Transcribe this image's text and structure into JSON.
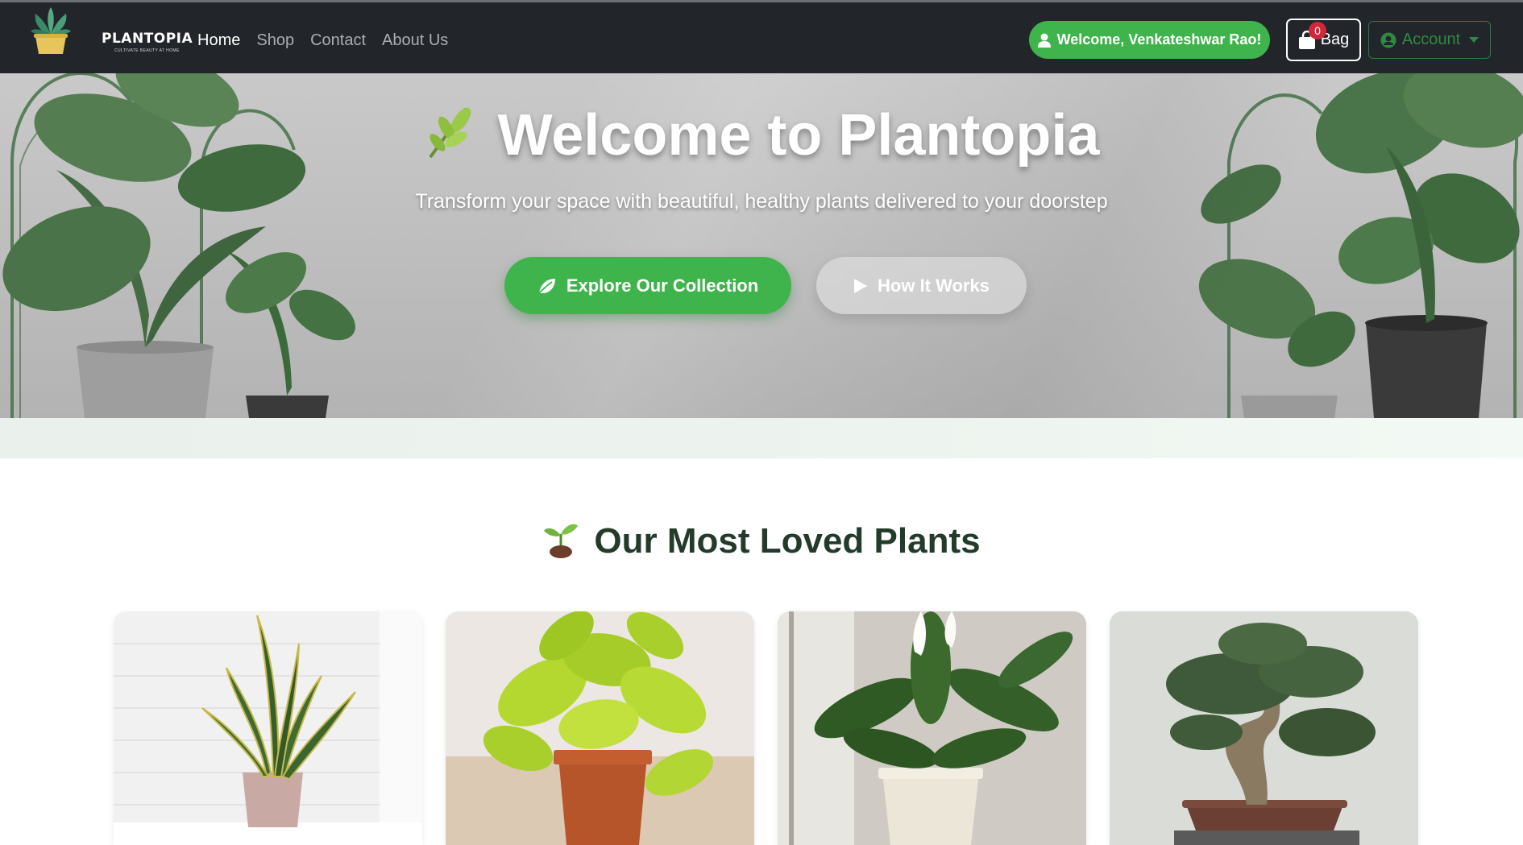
{
  "brand": {
    "name": "PLANTOPIA",
    "tagline": "CULTIVATE BEAUTY AT HOME",
    "logo_icon": "potted-plant-logo"
  },
  "nav": {
    "links": [
      {
        "label": "Home",
        "active": true
      },
      {
        "label": "Shop",
        "active": false
      },
      {
        "label": "Contact",
        "active": false
      },
      {
        "label": "About Us",
        "active": false
      }
    ],
    "welcome": "Welcome, Venkateshwar Rao!",
    "bag_label": "Bag",
    "bag_count": "0",
    "account_label": "Account"
  },
  "hero": {
    "title": "Welcome to Plantopia",
    "subtitle": "Transform your space with beautiful, healthy plants delivered to your doorstep",
    "explore_label": "Explore Our Collection",
    "how_label": "How It Works"
  },
  "section": {
    "title": "Our Most Loved Plants"
  },
  "products": [
    {
      "image": "snake-plant"
    },
    {
      "image": "golden-pothos"
    },
    {
      "image": "peace-lily"
    },
    {
      "image": "bonsai-tree"
    }
  ],
  "colors": {
    "navbar": "#22262b",
    "accent_green": "#3fb44c",
    "badge_red": "#d2263a",
    "heading": "#233b2b"
  }
}
